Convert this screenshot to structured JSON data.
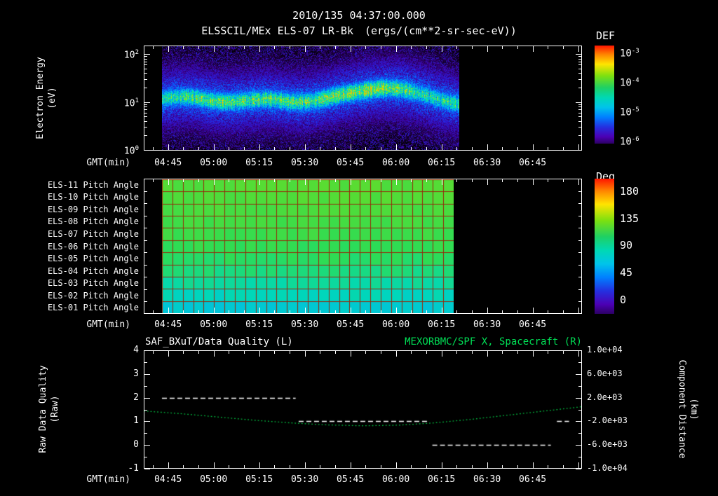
{
  "header": {
    "timestamp": "2010/135 04:37:00.000",
    "instrument": "ELSSCIL/MEx ELS-07 LR-Bk",
    "units_display": "(ergs/(cm**2-sr-sec-eV))"
  },
  "time_axis": {
    "label": "GMT(min)",
    "start_time": "04:37",
    "tick_labels": [
      "04:45",
      "05:00",
      "05:15",
      "05:30",
      "05:45",
      "06:00",
      "06:15",
      "06:30",
      "06:45"
    ]
  },
  "colors": {
    "background": "#000000",
    "foreground": "#ffffff",
    "green_text": "#00dd55",
    "green_curve": "#00c040",
    "grid_red": "#96280a"
  },
  "chart_data": [
    {
      "panel": "electron_energy_spectrogram",
      "type": "heatmap",
      "title": "ELSSCIL/MEx ELS-07 LR-Bk",
      "units": "ergs/(cm**2-sr-sec-eV)",
      "xlabel": "GMT(min)",
      "ylabel_lines": [
        "Electron Energy",
        "(eV)"
      ],
      "yscale": "log",
      "ylim_ev": [
        1,
        150
      ],
      "ytick_labels": [
        "10^0",
        "10^1",
        "10^2"
      ],
      "colorbar": {
        "title": "DEF",
        "scale": "log",
        "tick_labels": [
          "10^-3",
          "10^-4",
          "10^-5",
          "10^-6"
        ]
      },
      "data_start": "04:43",
      "data_end": "06:21",
      "features": "dense dark blue/purple noise above and below a bright cyan-green band centered near 10 eV; band intensifies and rises toward 20-40 eV between 05:40 and 06:10, data ends near 06:20"
    },
    {
      "panel": "pitch_angles",
      "type": "heatmap",
      "colorbar": {
        "title": "Deg",
        "tick_labels": [
          "180",
          "135",
          "90",
          "45",
          "0"
        ]
      },
      "data_start": "04:43",
      "data_end": "06:19",
      "columns": 28,
      "rows": [
        {
          "label": "ELS-11 Pitch Angle",
          "mean_deg": 96
        },
        {
          "label": "ELS-10 Pitch Angle",
          "mean_deg": 95
        },
        {
          "label": "ELS-09 Pitch Angle",
          "mean_deg": 93
        },
        {
          "label": "ELS-08 Pitch Angle",
          "mean_deg": 91
        },
        {
          "label": "ELS-07 Pitch Angle",
          "mean_deg": 89
        },
        {
          "label": "ELS-06 Pitch Angle",
          "mean_deg": 86
        },
        {
          "label": "ELS-05 Pitch Angle",
          "mean_deg": 83
        },
        {
          "label": "ELS-04 Pitch Angle",
          "mean_deg": 79
        },
        {
          "label": "ELS-03 Pitch Angle",
          "mean_deg": 74
        },
        {
          "label": "ELS-02 Pitch Angle",
          "mean_deg": 69
        },
        {
          "label": "ELS-01 Pitch Angle",
          "mean_deg": 63
        }
      ]
    },
    {
      "panel": "quality_and_distance",
      "type": "line",
      "title_left": "SAF_BXuT/Data Quality (L)",
      "title_right": "MEXORBMC/SPF X, Spacecraft (R)",
      "ylabel_left_lines": [
        "Raw Data Quality",
        "(Raw)"
      ],
      "ylabel_right_lines": [
        "Component Distance",
        "(km)"
      ],
      "ylim_left": [
        -1,
        4
      ],
      "ylim_right": [
        -10000,
        10000
      ],
      "ytick_labels_left": [
        "4",
        "3",
        "2",
        "1",
        "0",
        "-1"
      ],
      "ytick_labels_right": [
        "1.0e+04",
        "6.0e+03",
        "2.0e+03",
        "-2.0e+03",
        "-6.0e+03",
        "-1.0e+04"
      ],
      "series": [
        {
          "name": "SAF_BXuT/Data Quality",
          "axis": "left",
          "style": "white dashed",
          "segments": [
            {
              "value": 2,
              "start": "04:43",
              "end": "05:27"
            },
            {
              "value": 1,
              "start": "05:28",
              "end": "06:11"
            },
            {
              "value": 0,
              "start": "06:12",
              "end": "06:51"
            },
            {
              "value": 1,
              "start": "06:53",
              "end": "06:57"
            }
          ]
        },
        {
          "name": "MEXORBMC/SPF X Spacecraft",
          "axis": "right",
          "style": "green dotted",
          "t_minutes_from_start": [
            0,
            12,
            24,
            36,
            48,
            60,
            72,
            84,
            96,
            108,
            120,
            132,
            144
          ],
          "km": [
            -250,
            -700,
            -1250,
            -1800,
            -2250,
            -2600,
            -2750,
            -2650,
            -2250,
            -1650,
            -950,
            -250,
            450
          ]
        }
      ]
    }
  ]
}
